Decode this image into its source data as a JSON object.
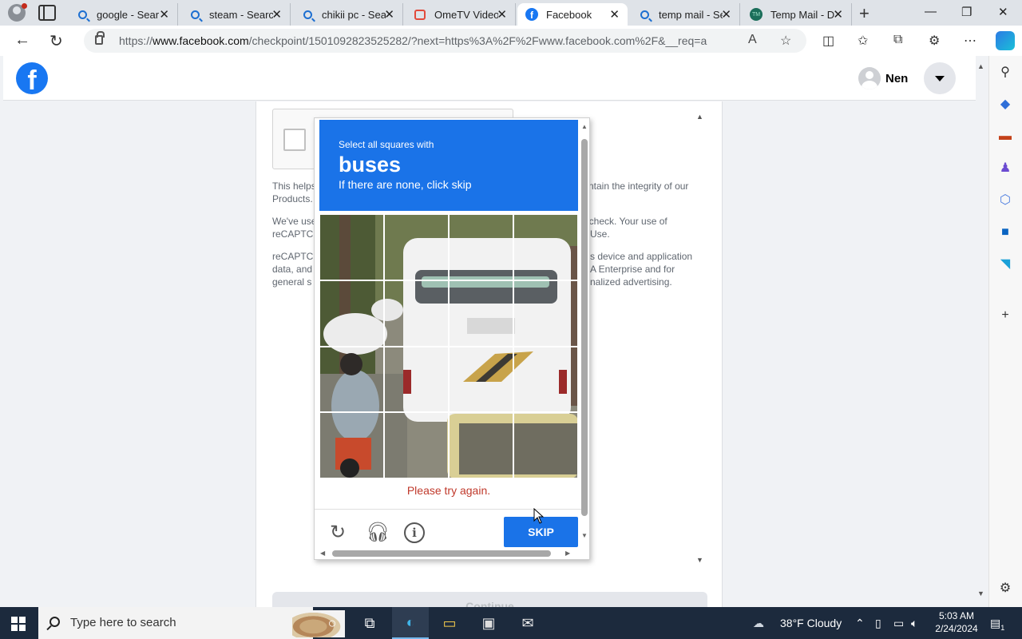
{
  "browser": {
    "tabs": [
      {
        "label": "google - Sear",
        "icon": "search-icon"
      },
      {
        "label": "steam - Searc",
        "icon": "search-icon"
      },
      {
        "label": "chikii pc - Sea",
        "icon": "search-icon"
      },
      {
        "label": "OmeTV Video",
        "icon": "ometv-icon"
      },
      {
        "label": "Facebook",
        "icon": "facebook-icon",
        "active": true
      },
      {
        "label": "temp mail - Se",
        "icon": "search-icon"
      },
      {
        "label": "Temp Mail - D",
        "icon": "tempmail-icon"
      }
    ],
    "url_prefix": "https://",
    "url_host": "www.facebook.com",
    "url_path": "/checkpoint/1501092823525282/?next=https%3A%2F%2Fwww.facebook.com%2F&__req=a"
  },
  "facebook": {
    "user_name": "Nen"
  },
  "explanation": {
    "p1_left": "This helps",
    "p1_right": "ntain the integrity of our",
    "p1_line2": "Products.",
    "p2_left1": "We've use",
    "p2_right1": "ty check. Your use of",
    "p2_left2": "reCAPTC",
    "p2_right2": "Use.",
    "p3_left1": "reCAPTC",
    "p3_right1": "s device and application",
    "p3_left2": "data, and",
    "p3_right2": "A Enterprise and for",
    "p3_left3": "general s",
    "p3_right3": "nalized advertising.",
    "continue_label": "Continue"
  },
  "captcha": {
    "instruction": "Select all squares with",
    "target": "buses",
    "hint": "If there are none, click skip",
    "error": "Please try again.",
    "skip_label": "SKIP",
    "grid_size": 4
  },
  "taskbar": {
    "search_placeholder": "Type here to search",
    "weather": "38°F  Cloudy",
    "time": "5:03 AM",
    "date": "2/24/2024",
    "notifications": "1"
  },
  "colors": {
    "facebook_blue": "#1877f2",
    "captcha_blue": "#1a73e8",
    "error_red": "#c0392b"
  }
}
